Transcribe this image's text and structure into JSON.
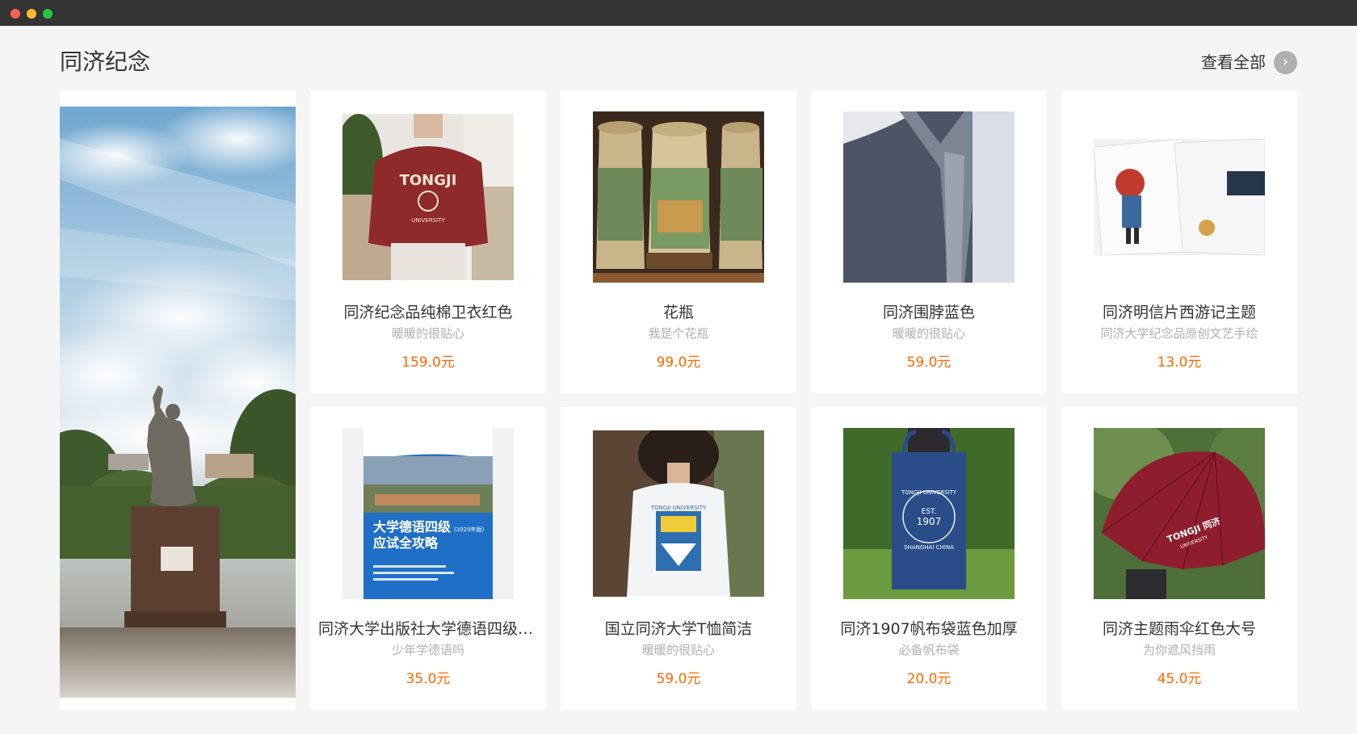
{
  "section": {
    "title": "同济纪念",
    "view_all_label": "查看全部",
    "view_all_icon": "chevron-right-icon"
  },
  "colors": {
    "price": "#ff6700",
    "title_bar": "#333333",
    "page_bg": "#f5f5f5"
  },
  "products": [
    {
      "name": "同济纪念品纯棉卫衣红色",
      "desc": "暖暖的很贴心",
      "price": "159.0元",
      "image": "red-sweatshirt"
    },
    {
      "name": "花瓶",
      "desc": "我是个花瓶",
      "price": "99.0元",
      "image": "ceramic-steins"
    },
    {
      "name": "同济围脖蓝色",
      "desc": "暖暖的很贴心",
      "price": "59.0元",
      "image": "blue-scarf"
    },
    {
      "name": "同济明信片西游记主题",
      "desc": "同济大学纪念品原创文艺手绘",
      "price": "13.0元",
      "image": "postcards"
    },
    {
      "name": "同济大学出版社大学德语四级应试全攻略",
      "desc": "少年学德语吗",
      "price": "35.0元",
      "image": "german-book"
    },
    {
      "name": "国立同济大学T恤简洁",
      "desc": "暖暖的很贴心",
      "price": "59.0元",
      "image": "white-tshirt"
    },
    {
      "name": "同济1907帆布袋蓝色加厚",
      "desc": "必备帆布袋",
      "price": "20.0元",
      "image": "canvas-bag"
    },
    {
      "name": "同济主题雨伞红色大号",
      "desc": "为你遮风挡雨",
      "price": "45.0元",
      "image": "red-umbrella"
    }
  ],
  "images": {
    "book_title_line1": "大学德语四级",
    "book_title_edition": "(2020年版)",
    "book_title_line2": "应试全攻略",
    "bag_text_line1": "TONGJI UNIVERSITY",
    "bag_text_est": "EST.",
    "bag_text_year": "1907",
    "bag_text_line2": "SHANGHAI CHINA",
    "umbrella_text": "TONGJI 同济",
    "umbrella_subtext": "UNIVERSITY",
    "sweatshirt_text": "TONGJI",
    "sweatshirt_subtext": "UNIVERSITY",
    "tshirt_text": "TONGJI UNIVERSITY"
  }
}
